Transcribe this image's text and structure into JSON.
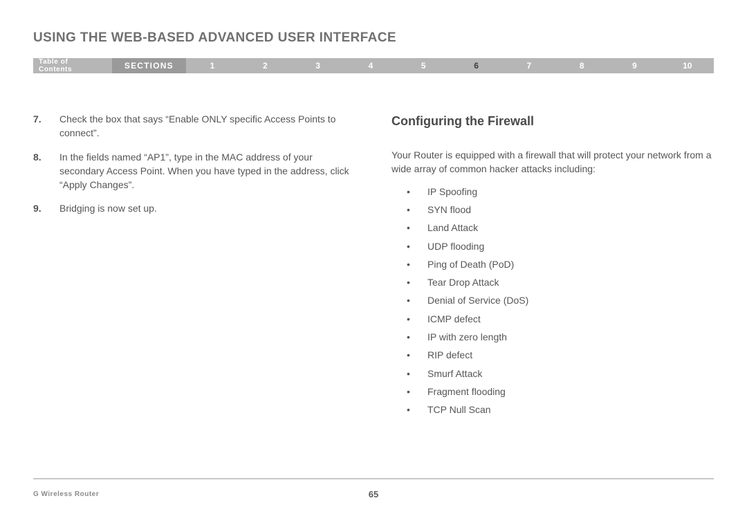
{
  "header": {
    "title": "USING THE WEB-BASED ADVANCED USER INTERFACE"
  },
  "navbar": {
    "toc_label": "Table of Contents",
    "sections_label": "SECTIONS",
    "sections": [
      "1",
      "2",
      "3",
      "4",
      "5",
      "6",
      "7",
      "8",
      "9",
      "10"
    ],
    "active": "6"
  },
  "left_steps": [
    {
      "num": "7.",
      "text": "Check the box that says “Enable ONLY specific Access Points to connect”."
    },
    {
      "num": "8.",
      "text": "In the fields named “AP1”, type in the MAC address of your secondary Access Point. When you have typed in the address, click “Apply Changes”."
    },
    {
      "num": "9.",
      "text": "Bridging is now set up."
    }
  ],
  "right": {
    "heading": "Configuring the Firewall",
    "intro": "Your Router is equipped with a firewall that will protect your network from a wide array of common hacker attacks including:",
    "bullets": [
      "IP Spoofing",
      "SYN flood",
      "Land Attack",
      "UDP flooding",
      "Ping of Death (PoD)",
      "Tear Drop Attack",
      "Denial of Service (DoS)",
      "ICMP defect",
      "IP with zero length",
      "RIP defect",
      "Smurf Attack",
      "Fragment flooding",
      "TCP Null Scan"
    ]
  },
  "footer": {
    "product": "G Wireless Router",
    "page": "65"
  }
}
